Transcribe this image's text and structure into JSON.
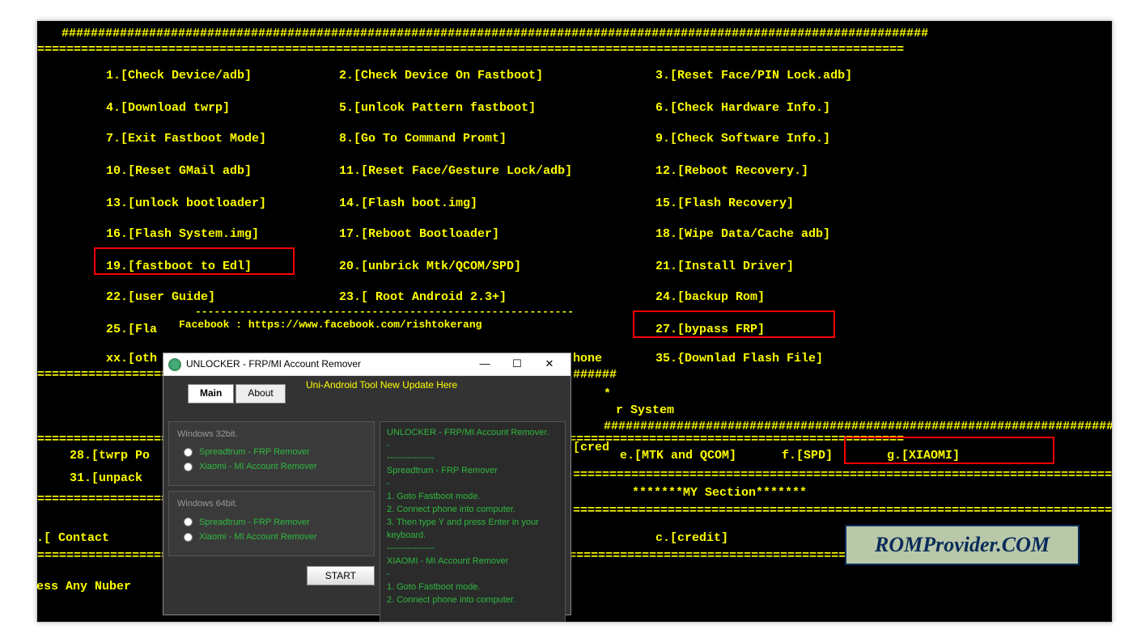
{
  "decor": {
    "hash": "#######################################################################################################################",
    "dash": "=======================================================================================================================",
    "shortdash": "-------------------------------------------------------------------------",
    "tinydash": "----------------"
  },
  "menu": {
    "c1": [
      {
        "n": "1",
        "t": "[Check Device/adb]"
      },
      {
        "n": "4",
        "t": "[Download twrp]"
      },
      {
        "n": "7",
        "t": "[Exit Fastboot Mode]"
      },
      {
        "n": "10",
        "t": "[Reset GMail adb]"
      },
      {
        "n": "13",
        "t": "[unlock bootloader]"
      },
      {
        "n": "16",
        "t": "[Flash System.img]"
      },
      {
        "n": "19",
        "t": "[fastboot to Edl]"
      },
      {
        "n": "22",
        "t": "[user Guide]"
      },
      {
        "n": "25",
        "t": "[Fla"
      },
      {
        "n": "xx",
        "t": "[oth"
      }
    ],
    "c2": [
      {
        "n": "2",
        "t": "[Check Device On Fastboot]"
      },
      {
        "n": "5",
        "t": "[unlcok Pattern fastboot]"
      },
      {
        "n": "8",
        "t": "[Go To Command Promt]"
      },
      {
        "n": "11",
        "t": "[Reset Face/Gesture Lock/adb]"
      },
      {
        "n": "14",
        "t": "[Flash boot.img]"
      },
      {
        "n": "17",
        "t": "[Reboot Bootloader]"
      },
      {
        "n": "20",
        "t": "[unbrick Mtk/QCOM/SPD]"
      },
      {
        "n": "23",
        "t": "[ Root Android 2.3+]"
      }
    ],
    "c3": [
      {
        "n": "3",
        "t": "[Reset Face/PIN Lock.adb]"
      },
      {
        "n": "6",
        "t": "[Check Hardware Info.]"
      },
      {
        "n": "9",
        "t": "[Check Software Info.]"
      },
      {
        "n": "12",
        "t": "[Reboot Recovery.]"
      },
      {
        "n": "15",
        "t": "[Flash Recovery]"
      },
      {
        "n": "18",
        "t": "[Wipe Data/Cache adb]"
      },
      {
        "n": "21",
        "t": "[Install Driver]"
      },
      {
        "n": "24",
        "t": "[backup Rom]"
      },
      {
        "n": "27",
        "t": "[bypass FRP]"
      },
      {
        "n": "35",
        "t": "{Downlad Flash File]"
      }
    ]
  },
  "fb_line": "Facebook : https://www.facebook.com/rishtokerang",
  "frag": {
    "hone": "hone",
    "r_system": "r System",
    "hashrow2": "#########################################",
    "cred": "[cred",
    "star": "*",
    "e": "e.[MTK and QCOM]",
    "f": "f.[SPD]",
    "g": "g.[XIAOMI]",
    "my": "*******MY Section*******",
    "c": "c.[credit]",
    "i28": "28.[twrp Po",
    "i31": "31.[unpack",
    "a": "a.[ Contact",
    "press": "ress Any Nuber"
  },
  "dialog": {
    "title": "UNLOCKER - FRP/MI Account Remover",
    "banner": "Uni-Android Tool New Update Here",
    "tabs": {
      "main": "Main",
      "about": "About"
    },
    "g32": "Windows 32bit.",
    "g64": "Windows 64bit.",
    "opt_sp": "Spreadtrum - FRP Remover",
    "opt_mi": "Xiaomi - MI Account Remover",
    "start": "START",
    "log": "UNLOCKER - FRP/MI Account Remover.\n-\n----------------\nSpreadtrum - FRP Remover\n-\n1. Goto Fastboot mode.\n2. Connect phone into computer.\n3. Then type Y and press Enter in your keyboard.\n----------------\nXIAOMI - MI Account Remover\n-\n1. Goto Fastboot mode.\n2. Connect phone into computer."
  },
  "watermark": "ROMProvider.COM"
}
